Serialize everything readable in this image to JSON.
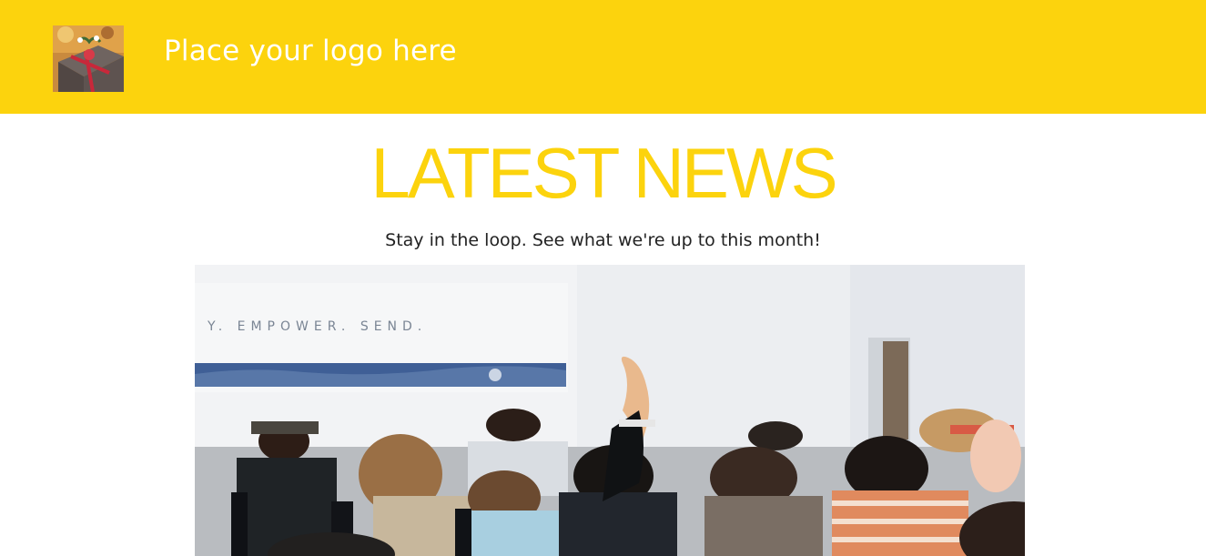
{
  "header": {
    "background": "#fcd30d",
    "logo_text": "Place your logo here",
    "logo_image": "gift-box-photo"
  },
  "main": {
    "headline": "LATEST NEWS",
    "headline_color": "#fcd30d",
    "subheadline": "Stay in the loop. See what we're up to this month!",
    "hero_image": "classroom-students-raising-hand-photo",
    "banner_text": "Y. EMPOWER. SEND."
  }
}
